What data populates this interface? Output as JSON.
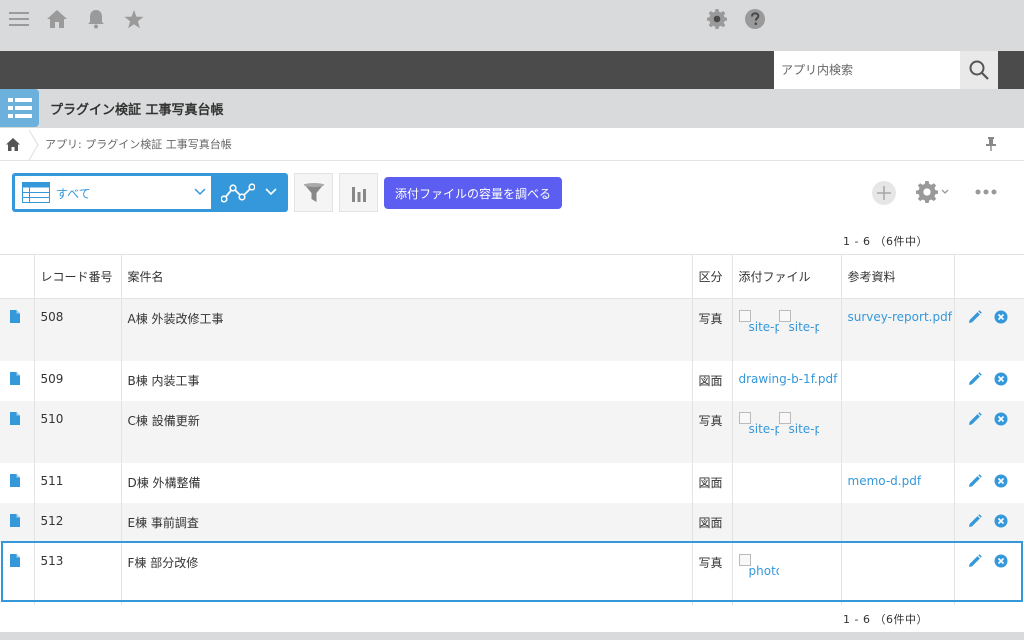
{
  "header": {
    "search_placeholder": "アプリ内検索",
    "icons": [
      "menu-icon",
      "home-icon",
      "bell-icon",
      "star-icon",
      "gear-icon",
      "help-icon",
      "search-icon"
    ]
  },
  "app": {
    "title": "プラグイン検証 工事写真台帳",
    "breadcrumb": "アプリ: プラグイン検証 工事写真台帳"
  },
  "toolbar": {
    "view_label": "すべて",
    "plugin_button": "添付ファイルの容量を調べる"
  },
  "pagination": {
    "top": "1 - 6 （6件中）",
    "bottom": "1 - 6 （6件中）"
  },
  "table": {
    "headers": [
      "レコード番号",
      "案件名",
      "区分",
      "添付ファイル",
      "参考資料"
    ],
    "rows": [
      {
        "id": "508",
        "name": "A棟 外装改修工事",
        "kind": "写真",
        "attach": "",
        "attach_images": [
          "site-p",
          "site-p"
        ],
        "ref": "survey-report.pdf"
      },
      {
        "id": "509",
        "name": "B棟 内装工事",
        "kind": "図面",
        "attach": "drawing-b-1f.pdf",
        "attach_images": [],
        "ref": ""
      },
      {
        "id": "510",
        "name": "C棟 設備更新",
        "kind": "写真",
        "attach": "",
        "attach_images": [
          "site-p",
          "site-p"
        ],
        "ref": ""
      },
      {
        "id": "511",
        "name": "D棟 外構整備",
        "kind": "図面",
        "attach": "",
        "attach_images": [],
        "ref": "memo-d.pdf"
      },
      {
        "id": "512",
        "name": "E棟 事前調査",
        "kind": "図面",
        "attach": "",
        "attach_images": [],
        "ref": ""
      },
      {
        "id": "513",
        "name": "F棟 部分改修",
        "kind": "写真",
        "attach": "",
        "attach_images": [
          "photo"
        ],
        "ref": ""
      }
    ]
  },
  "colors": {
    "header_bg": "#4b4b4b",
    "accent": "#3498db",
    "plugin_button": "#5b5ef0"
  }
}
